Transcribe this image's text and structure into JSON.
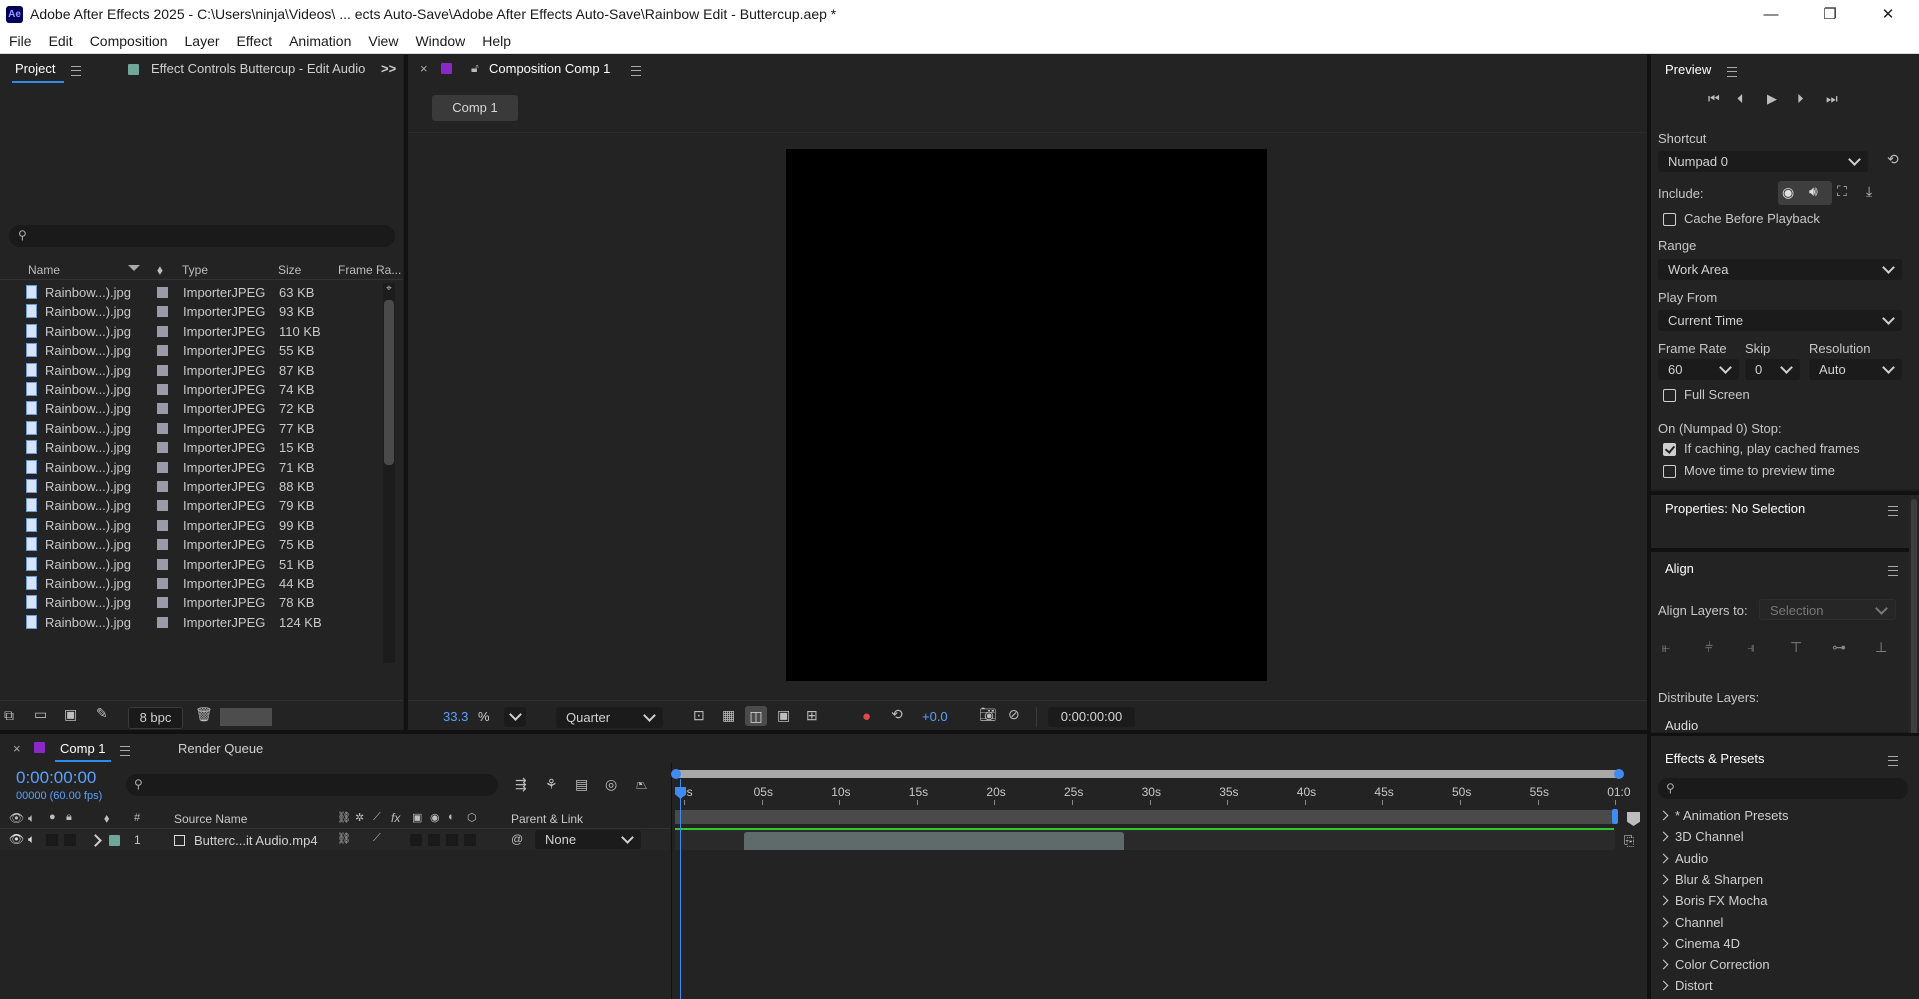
{
  "window": {
    "title": "Adobe After Effects 2025 - C:\\Users\\ninja\\Videos\\ ... ects Auto-Save\\Adobe After Effects Auto-Save\\Rainbow Edit - Buttercup.aep *",
    "app_icon": "Ae",
    "minimize": "—",
    "restore": "❐",
    "close": "✕"
  },
  "menu": [
    "File",
    "Edit",
    "Composition",
    "Layer",
    "Effect",
    "Animation",
    "View",
    "Window",
    "Help"
  ],
  "project_panel": {
    "tab_project": "Project",
    "tab_effect_controls": "Effect Controls Buttercup - Edit Audio",
    "overflow": ">>",
    "columns": {
      "name": "Name",
      "type": "Type",
      "size": "Size",
      "frame_rate": "Frame Ra..."
    },
    "rows": [
      {
        "name": "Rainbow...).jpg",
        "type": "ImporterJPEG",
        "size": "63 KB"
      },
      {
        "name": "Rainbow...).jpg",
        "type": "ImporterJPEG",
        "size": "93 KB"
      },
      {
        "name": "Rainbow...).jpg",
        "type": "ImporterJPEG",
        "size": "110 KB"
      },
      {
        "name": "Rainbow...).jpg",
        "type": "ImporterJPEG",
        "size": "55 KB"
      },
      {
        "name": "Rainbow...).jpg",
        "type": "ImporterJPEG",
        "size": "87 KB"
      },
      {
        "name": "Rainbow...).jpg",
        "type": "ImporterJPEG",
        "size": "74 KB"
      },
      {
        "name": "Rainbow...).jpg",
        "type": "ImporterJPEG",
        "size": "72 KB"
      },
      {
        "name": "Rainbow...).jpg",
        "type": "ImporterJPEG",
        "size": "77 KB"
      },
      {
        "name": "Rainbow...).jpg",
        "type": "ImporterJPEG",
        "size": "15 KB"
      },
      {
        "name": "Rainbow...).jpg",
        "type": "ImporterJPEG",
        "size": "71 KB"
      },
      {
        "name": "Rainbow...).jpg",
        "type": "ImporterJPEG",
        "size": "88 KB"
      },
      {
        "name": "Rainbow...).jpg",
        "type": "ImporterJPEG",
        "size": "79 KB"
      },
      {
        "name": "Rainbow...).jpg",
        "type": "ImporterJPEG",
        "size": "99 KB"
      },
      {
        "name": "Rainbow...).jpg",
        "type": "ImporterJPEG",
        "size": "75 KB"
      },
      {
        "name": "Rainbow...).jpg",
        "type": "ImporterJPEG",
        "size": "51 KB"
      },
      {
        "name": "Rainbow...).jpg",
        "type": "ImporterJPEG",
        "size": "44 KB"
      },
      {
        "name": "Rainbow...).jpg",
        "type": "ImporterJPEG",
        "size": "78 KB"
      },
      {
        "name": "Rainbow...).jpg",
        "type": "ImporterJPEG",
        "size": "124 KB"
      }
    ],
    "bpc": "8 bpc"
  },
  "comp_panel": {
    "close": "×",
    "tab_title": "Composition Comp 1",
    "comp_chip": "Comp 1",
    "zoom": "33.3",
    "zoom_unit": "%",
    "resolution": "Quarter",
    "exposure": "+0.0",
    "timecode": "0:00:00:00"
  },
  "preview_panel": {
    "title": "Preview",
    "shortcut_label": "Shortcut",
    "shortcut_value": "Numpad 0",
    "include_label": "Include:",
    "cache_before_playback": "Cache Before Playback",
    "range_label": "Range",
    "range_value": "Work Area",
    "play_from_label": "Play From",
    "play_from_value": "Current Time",
    "frame_rate_label": "Frame Rate",
    "frame_rate_value": "60",
    "skip_label": "Skip",
    "skip_value": "0",
    "resolution_label": "Resolution",
    "resolution_value": "Auto",
    "full_screen": "Full Screen",
    "stop_label": "On (Numpad 0) Stop:",
    "if_caching": "If caching, play cached frames",
    "move_time": "Move time to preview time"
  },
  "properties_panel": {
    "title": "Properties: No Selection"
  },
  "align_panel": {
    "title": "Align",
    "align_to_label": "Align Layers to:",
    "align_to_value": "Selection",
    "distribute_label": "Distribute Layers:",
    "audio_tab": "Audio"
  },
  "effects_panel": {
    "title": "Effects & Presets",
    "items": [
      "* Animation Presets",
      "3D Channel",
      "Audio",
      "Blur & Sharpen",
      "Boris FX Mocha",
      "Channel",
      "Cinema 4D",
      "Color Correction",
      "Distort"
    ]
  },
  "timeline": {
    "close": "×",
    "tab_comp": "Comp 1",
    "tab_render": "Render Queue",
    "timecode": "0:00:00:00",
    "frames": "00000 (60.00 fps)",
    "col_source": "Source Name",
    "col_parent": "Parent & Link",
    "col_num": "#",
    "ruler": [
      "0s",
      "05s",
      "10s",
      "15s",
      "20s",
      "25s",
      "30s",
      "35s",
      "40s",
      "45s",
      "50s",
      "55s",
      "01:0"
    ],
    "layer": {
      "index": "1",
      "name": "Butterc...it Audio.mp4",
      "parent": "None"
    }
  },
  "colors": {
    "accent_blue": "#2d8ceb",
    "timecode_blue": "#5aa0ff",
    "label_purple": "#8a28c8",
    "label_teal": "#6fa89b",
    "work_area_green": "#2ec92e"
  }
}
